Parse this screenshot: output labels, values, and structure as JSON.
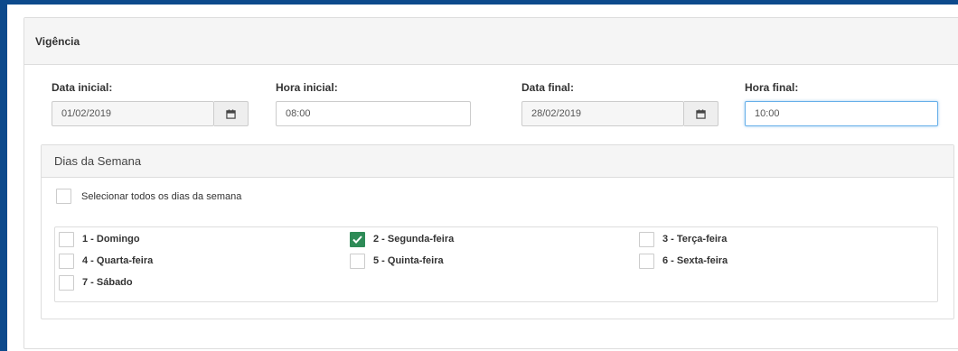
{
  "panel": {
    "title": "Vigência"
  },
  "fields": {
    "start_date": {
      "label": "Data inicial:",
      "value": "01/02/2019"
    },
    "start_time": {
      "label": "Hora inicial:",
      "value": "08:00"
    },
    "end_date": {
      "label": "Data final:",
      "value": "28/02/2019"
    },
    "end_time": {
      "label": "Hora final:",
      "value": "10:00"
    }
  },
  "weekdays": {
    "title": "Dias da Semana",
    "select_all_label": "Selecionar todos os dias da semana",
    "select_all_checked": false,
    "days": [
      {
        "label": "1 - Domingo",
        "checked": false
      },
      {
        "label": "2 - Segunda-feira",
        "checked": true
      },
      {
        "label": "3 - Terça-feira",
        "checked": false
      },
      {
        "label": "4 - Quarta-feira",
        "checked": false
      },
      {
        "label": "5 - Quinta-feira",
        "checked": false
      },
      {
        "label": "6 - Sexta-feira",
        "checked": false
      },
      {
        "label": "7 - Sábado",
        "checked": false
      }
    ]
  },
  "icons": {
    "calendar": "calendar-icon",
    "check": "check-icon"
  },
  "colors": {
    "frame": "#0d4a8c",
    "checked": "#2e8b57",
    "focus": "#66afe9"
  }
}
